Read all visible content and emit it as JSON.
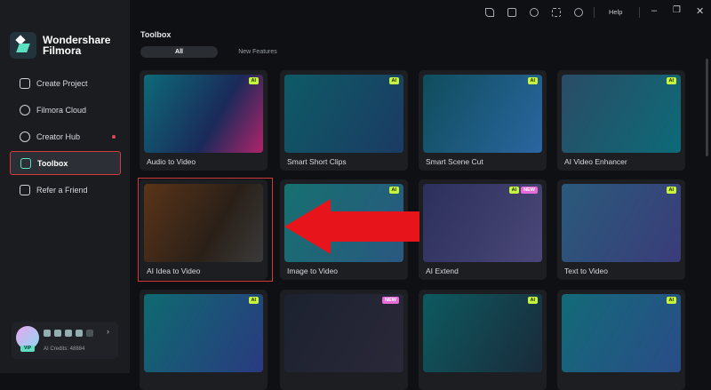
{
  "app": {
    "name": "Wondershare Filmora"
  },
  "sidebar": {
    "items": [
      {
        "label": "Create Project"
      },
      {
        "label": "Filmora Cloud"
      },
      {
        "label": "Creator Hub"
      },
      {
        "label": "Toolbox"
      },
      {
        "label": "Refer a Friend"
      }
    ],
    "user": {
      "vip": "VIP",
      "credits": "AI Credits: 48884"
    }
  },
  "topbar": {
    "help": "Help"
  },
  "main": {
    "title": "Toolbox",
    "tabs": [
      {
        "label": "All"
      },
      {
        "label": "New Features"
      }
    ],
    "cards": [
      {
        "label": "Audio to Video",
        "ai": "AI"
      },
      {
        "label": "Smart Short Clips",
        "ai": "AI"
      },
      {
        "label": "Smart Scene Cut",
        "ai": "AI"
      },
      {
        "label": "AI Video Enhancer",
        "ai": "AI"
      },
      {
        "label": "AI Idea to Video"
      },
      {
        "label": "Image to Video",
        "ai": "AI"
      },
      {
        "label": "AI Extend",
        "ai": "AI",
        "new": "NEW"
      },
      {
        "label": "Text to Video",
        "ai": "AI"
      },
      {
        "label": "",
        "ai": "AI"
      },
      {
        "label": "",
        "new": "NEW"
      },
      {
        "label": "",
        "ai": "AI"
      },
      {
        "label": "",
        "ai": "AI"
      }
    ]
  },
  "colors": {
    "accent": "#5de0c2",
    "highlight": "#d33b3b",
    "arrow": "#e8141c",
    "ai_badge": "#c8f53c",
    "new_badge": "#e66bd9"
  }
}
